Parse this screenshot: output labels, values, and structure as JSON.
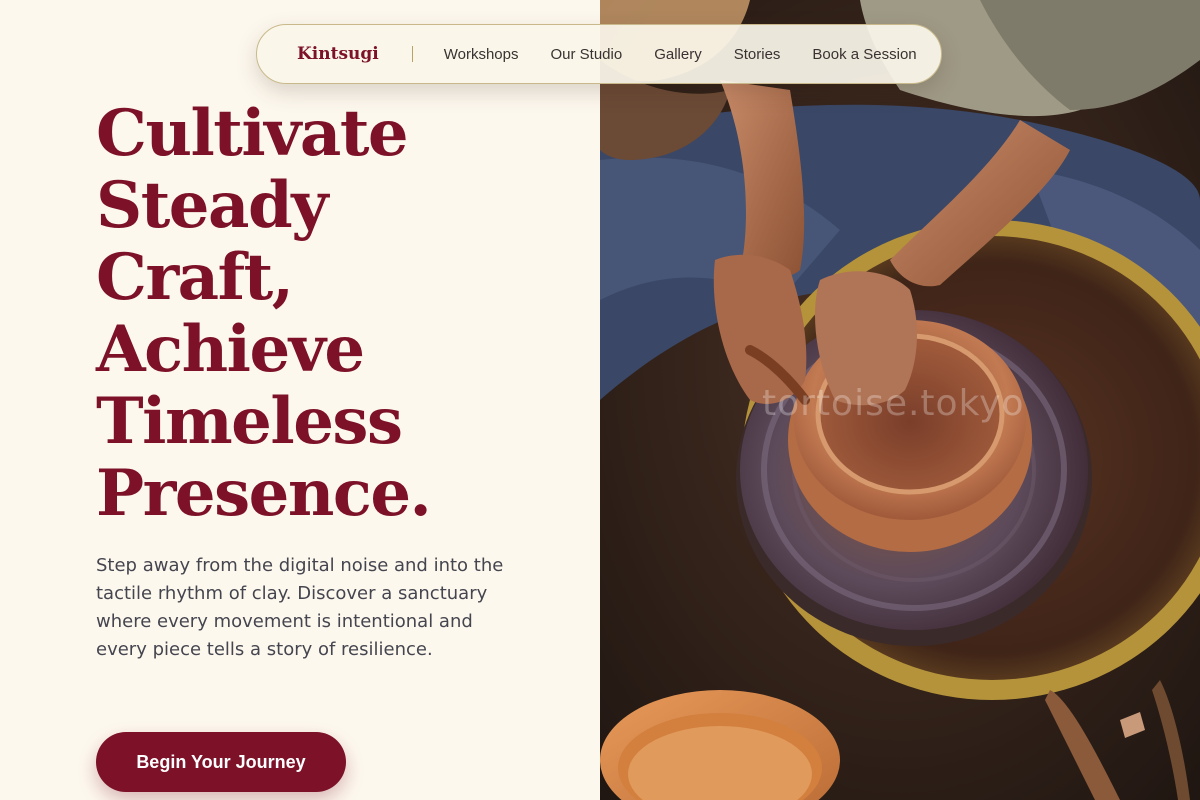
{
  "nav": {
    "brand": "Kintsugi",
    "links": [
      "Workshops",
      "Our Studio",
      "Gallery",
      "Stories",
      "Book a Session"
    ]
  },
  "hero": {
    "title_lines": [
      "Cultivate",
      "Steady",
      "Craft,",
      "Achieve",
      "Timeless",
      "Presence."
    ],
    "body": "Step away from the digital noise and into the tactile rhythm of clay. Discover a sanctuary where every movement is intentional and every piece tells a story of resilience.",
    "cta_label": "Begin Your Journey"
  },
  "image": {
    "watermark": "tortoise.tokyo",
    "subject": "pottery-wheel-photo"
  },
  "colors": {
    "background": "#fdf8ee",
    "accent": "#7c1128",
    "body_text": "#45454f",
    "nav_border": "#c9b98a"
  }
}
